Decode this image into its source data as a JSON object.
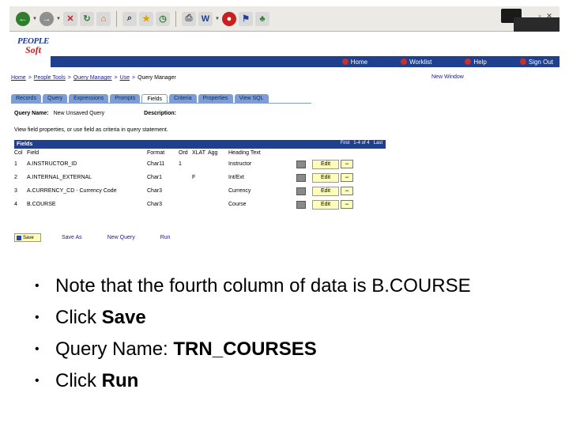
{
  "peoplesoft": {
    "logo_line1": "PEOPLE",
    "logo_line2": "Soft",
    "nav": [
      {
        "label": "Home",
        "icon": "home-icon",
        "color": "#c4322a"
      },
      {
        "label": "Worklist",
        "icon": "worklist-icon",
        "color": "#c4322a"
      },
      {
        "label": "Help",
        "icon": "help-icon",
        "color": "#c4322a"
      },
      {
        "label": "Sign Out",
        "icon": "signout-icon",
        "color": "#c4322a"
      }
    ],
    "breadcrumb": [
      "Home",
      "People Tools",
      "Query Manager",
      "Use",
      "Query Manager"
    ],
    "new_window": "New Window",
    "tabs": [
      "Records",
      "Query",
      "Expressions",
      "Prompts",
      "Fields",
      "Criteria",
      "Properties",
      "View SQL"
    ],
    "active_tab": 4,
    "query_name_label": "Query Name:",
    "query_name_value": "New Unsaved Query",
    "description_label": "Description:",
    "view_text": "View field properties, or use field as criteria in query statement.",
    "grid": {
      "title": "Fields",
      "nav": [
        "First",
        "1-4 of 4",
        "Last"
      ],
      "columns": [
        "Col",
        "Field",
        "Format",
        "Ord",
        "XLAT",
        "Agg",
        "Heading Text"
      ],
      "rows": [
        {
          "col": "1",
          "field": "A.INSTRUCTOR_ID",
          "format": "Char11",
          "ord": "1",
          "xlat": "",
          "agg": "",
          "heading": "Instructor",
          "edit": "Edit",
          "remove": "−"
        },
        {
          "col": "2",
          "field": "A.INTERNAL_EXTERNAL",
          "format": "Char1",
          "ord": "",
          "xlat": "F",
          "agg": "",
          "heading": "Int/Ext",
          "edit": "Edit",
          "remove": "−"
        },
        {
          "col": "3",
          "field": "A.CURRENCY_CD - Currency Code",
          "format": "Char3",
          "ord": "",
          "xlat": "",
          "agg": "",
          "heading": "Currency",
          "edit": "Edit",
          "remove": "−"
        },
        {
          "col": "4",
          "field": "B.COURSE",
          "format": "Char3",
          "ord": "",
          "xlat": "",
          "agg": "",
          "heading": "Course",
          "edit": "Edit",
          "remove": "−"
        }
      ]
    },
    "actions": {
      "save": "Save",
      "save_as": "Save As",
      "new_query": "New Query",
      "run": "Run"
    }
  },
  "bullets": [
    {
      "plain": "Note that the fourth column of data is B.COURSE",
      "bold": ""
    },
    {
      "plain": "Click ",
      "bold": "Save"
    },
    {
      "plain": "Query Name: ",
      "bold": "TRN_COURSES"
    },
    {
      "plain": "Click ",
      "bold": "Run"
    }
  ]
}
